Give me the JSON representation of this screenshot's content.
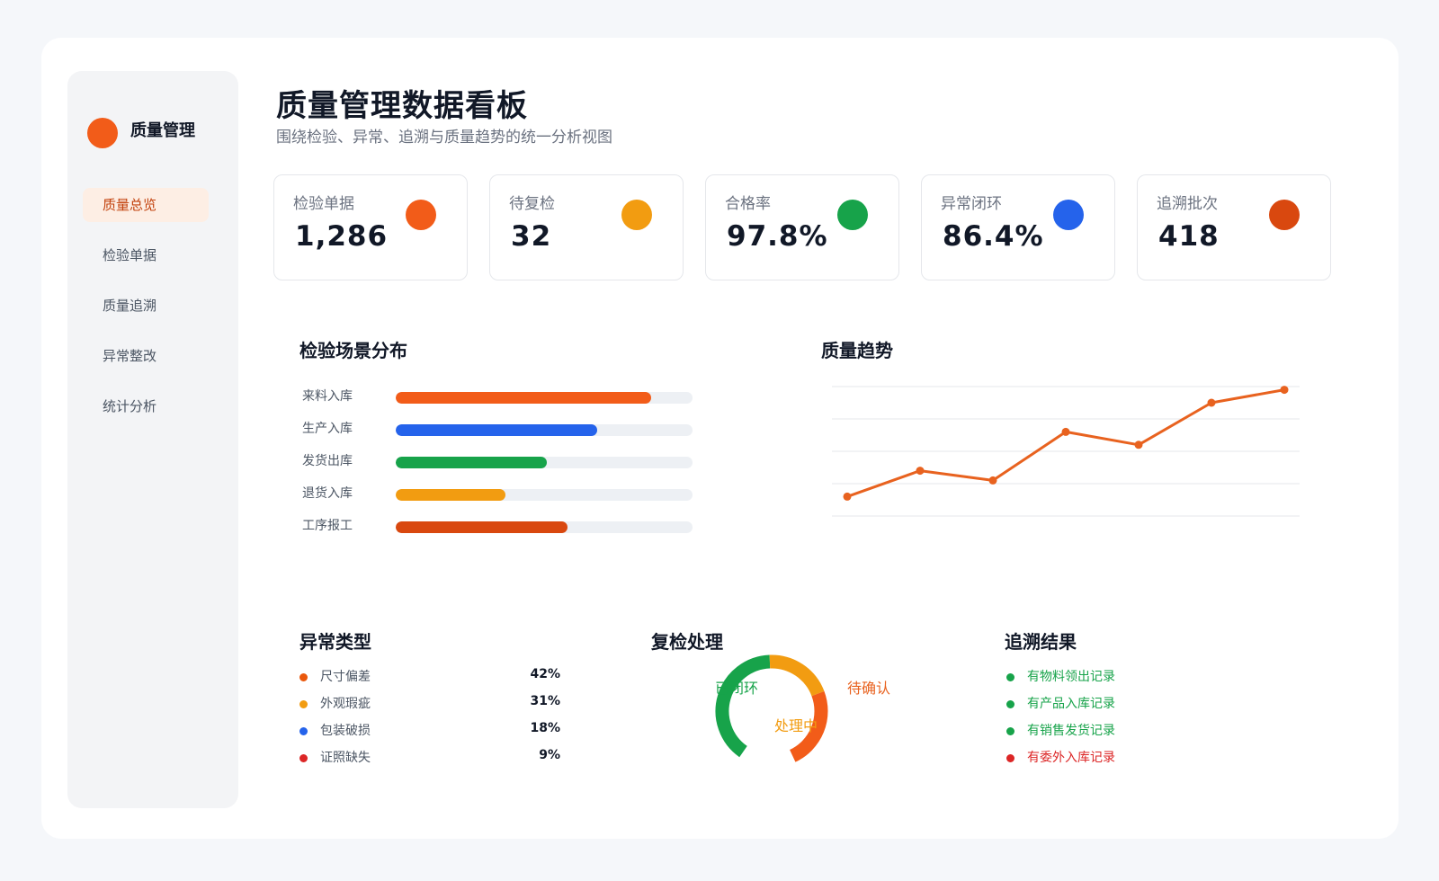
{
  "brand": {
    "title": "质量管理",
    "color": "#f25c19"
  },
  "nav": {
    "items": [
      {
        "label": "质量总览",
        "active": true
      },
      {
        "label": "检验单据",
        "active": false
      },
      {
        "label": "质量追溯",
        "active": false
      },
      {
        "label": "异常整改",
        "active": false
      },
      {
        "label": "统计分析",
        "active": false
      }
    ]
  },
  "header": {
    "title": "质量管理数据看板",
    "subtitle": "围绕检验、异常、追溯与质量趋势的统一分析视图"
  },
  "kpis": [
    {
      "label": "检验单据",
      "value": "1,286",
      "color": "#f25c19"
    },
    {
      "label": "待复检",
      "value": "32",
      "color": "#f29c11"
    },
    {
      "label": "合格率",
      "value": "97.8%",
      "color": "#17a34a"
    },
    {
      "label": "异常闭环",
      "value": "86.4%",
      "color": "#2563eb"
    },
    {
      "label": "追溯批次",
      "value": "418",
      "color": "#d9480f"
    }
  ],
  "scene_distribution": {
    "title": "检验场景分布"
  },
  "quality_trend": {
    "title": "质量趋势"
  },
  "anomaly_types": {
    "title": "异常类型",
    "items": [
      {
        "label": "尺寸偏差",
        "value": "42%",
        "color": "#ea580c"
      },
      {
        "label": "外观瑕疵",
        "value": "31%",
        "color": "#f29c11"
      },
      {
        "label": "包装破损",
        "value": "18%",
        "color": "#2563eb"
      },
      {
        "label": "证照缺失",
        "value": "9%",
        "color": "#dc2626"
      }
    ]
  },
  "recheck": {
    "title": "复检处理",
    "labels": {
      "closed": "已闭环",
      "processing": "处理中",
      "pending": "待确认"
    }
  },
  "trace_results": {
    "title": "追溯结果",
    "items": [
      {
        "label": "有物料领出记录",
        "color": "#17a34a"
      },
      {
        "label": "有产品入库记录",
        "color": "#17a34a"
      },
      {
        "label": "有销售发货记录",
        "color": "#17a34a"
      },
      {
        "label": "有委外入库记录",
        "color": "#dc2626"
      }
    ]
  },
  "chart_data": [
    {
      "type": "bar",
      "orientation": "horizontal",
      "categories": [
        "来料入库",
        "生产入库",
        "发货出库",
        "退货入库",
        "工序报工"
      ],
      "values": [
        86,
        68,
        51,
        37,
        58
      ],
      "colors": [
        "#f25c19",
        "#2563eb",
        "#17a34a",
        "#f29c11",
        "#d9480f"
      ],
      "xlim": [
        0,
        100
      ],
      "grid": false
    },
    {
      "type": "line",
      "x": [
        1,
        2,
        3,
        4,
        5,
        6,
        7
      ],
      "values": [
        66,
        74,
        71,
        86,
        82,
        95,
        99
      ],
      "ylim": [
        60,
        100
      ],
      "color": "#e8621f",
      "grid": true
    },
    {
      "type": "pie",
      "style": "donut",
      "categories": [
        "已闭环",
        "处理中",
        "待确认"
      ],
      "values": [
        40,
        20,
        24
      ],
      "colors": [
        "#17a34a",
        "#f29c11",
        "#f25c19"
      ]
    }
  ]
}
